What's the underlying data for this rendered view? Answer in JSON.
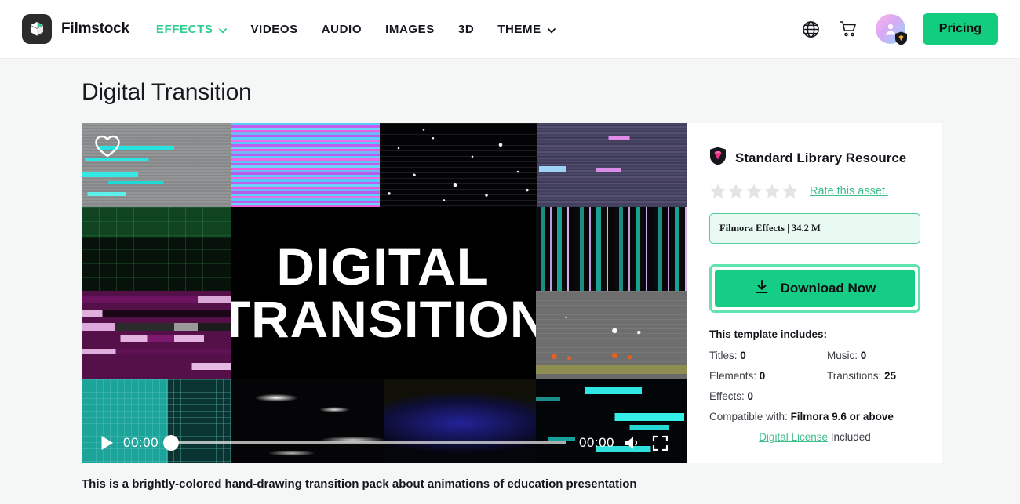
{
  "header": {
    "brand": "Filmstock",
    "logo_icon": "filmstock-logo-icon",
    "nav": [
      {
        "label": "EFFECTS",
        "active": true,
        "has_chevron": true
      },
      {
        "label": "VIDEOS",
        "active": false,
        "has_chevron": false
      },
      {
        "label": "AUDIO",
        "active": false,
        "has_chevron": false
      },
      {
        "label": "IMAGES",
        "active": false,
        "has_chevron": false
      },
      {
        "label": "3D",
        "active": false,
        "has_chevron": false
      },
      {
        "label": "THEME",
        "active": false,
        "has_chevron": true
      }
    ],
    "globe_icon": "globe-icon",
    "cart_icon": "shopping-cart-icon",
    "avatar_icon": "user-avatar",
    "avatar_badge_icon": "shield-badge-icon",
    "pricing_label": "Pricing",
    "accent_green": "#2fcf8f",
    "pricing_bg": "#12cd7d"
  },
  "page": {
    "title": "Digital Transition",
    "description": "This is a brightly-colored hand-drawing transition pack about animations of education presentation"
  },
  "player": {
    "favorite_icon": "heart-icon",
    "play_icon": "play-icon",
    "current_time": "00:00",
    "duration": "00:00",
    "volume_icon": "volume-icon",
    "fullscreen_icon": "fullscreen-icon",
    "progress_percent": 0,
    "overlay_title_line1": "DIGITAL",
    "overlay_title_line2": "TRANSITION"
  },
  "info": {
    "resource_icon": "shield-gem-icon",
    "resource_title": "Standard Library Resource",
    "rating": 0,
    "star_count": 5,
    "rate_link": "Rate this asset.",
    "category_badge": "Filmora Effects | 34.2 M",
    "download_icon": "download-icon",
    "download_label": "Download Now",
    "includes_title": "This template includes:",
    "specs": [
      {
        "label": "Titles:",
        "value": "0"
      },
      {
        "label": "Music:",
        "value": "0"
      },
      {
        "label": "Elements:",
        "value": "0"
      },
      {
        "label": "Transitions:",
        "value": "25"
      },
      {
        "label": "Effects:",
        "value": "0"
      }
    ],
    "compatible_label": "Compatible with:",
    "compatible_value": "Filmora 9.6 or above",
    "license_link": "Digital License",
    "license_suffix": "Included"
  }
}
